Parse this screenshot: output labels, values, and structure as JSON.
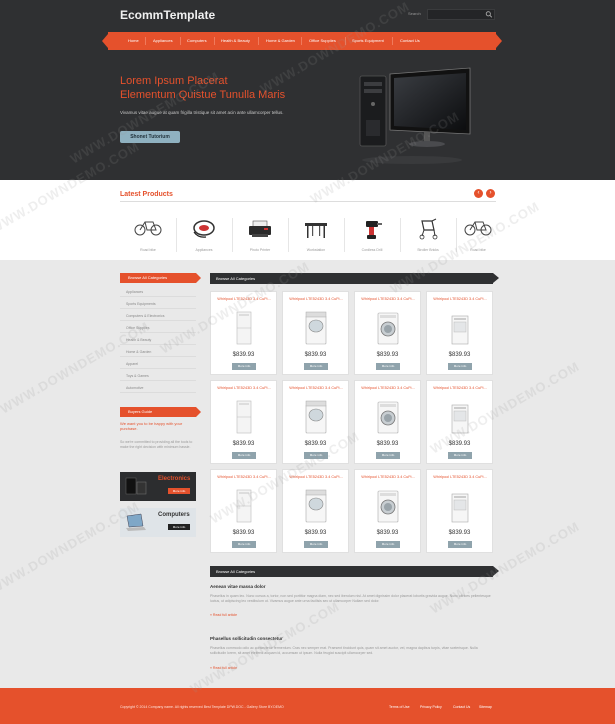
{
  "header": {
    "logo": "EcommTemplate",
    "search_label": "Search",
    "search_placeholder": "",
    "nav": [
      "Home",
      "Appliances",
      "Computers",
      "Health & Beauty",
      "Home & Garden",
      "Office Supplies",
      "Sports Equipment",
      "Contact Us"
    ]
  },
  "hero": {
    "title_line1": "Lorem Ipsum Placerat",
    "title_line2": "Elementum Quistue Tunulla Maris",
    "text": "Vivamus vitae augue at quam frigilla tristique sit amet acin ante ullamcorper  tellus.",
    "button": "Shonet Tutorium"
  },
  "latest": {
    "title": "Latest Products",
    "prev": "‹",
    "next": "›",
    "items": [
      "Road bike",
      "Appliances",
      "Photo Printer",
      "Workstation",
      "Cordless Drill",
      "Stroller Bricks",
      "Road bike"
    ]
  },
  "sidebar": {
    "categories_title": "Browse All Categories",
    "categories": [
      "Appliances",
      "Sports Equipments",
      "Computers & Electronics",
      "Office Supplies",
      "Health & Beauty",
      "Home & Garden",
      "Apparel",
      "Toys & Games",
      "Automotive"
    ],
    "buyers_title": "Buyers Guide",
    "buyers_text_a": "We want you to be happy with your purchase.",
    "buyers_text_b": "So we're committed to providing all the tools to make the right decision with minimum hassle.",
    "promo1_title": "Electronics",
    "promo1_btn": "More info",
    "promo2_title": "Computers",
    "promo2_btn": "More info"
  },
  "main": {
    "grid_title": "Browse All Categories",
    "products": [
      {
        "name": "Whirlpool LTE5243D 3.4 CuFt...",
        "price": "$839.93",
        "btn": "More info",
        "img": "stack-washer-icon"
      },
      {
        "name": "Whirlpool LTE5243D 3.4 CuFt...",
        "price": "$839.93",
        "btn": "More info",
        "img": "top-load-washer-icon"
      },
      {
        "name": "Whirlpool LTE5243D 3.4 CuFt...",
        "price": "$839.93",
        "btn": "More info",
        "img": "front-load-washer-icon"
      },
      {
        "name": "Whirlpool LTE5243D 3.4 CuFt...",
        "price": "$839.93",
        "btn": "More info",
        "img": "compact-washer-icon"
      },
      {
        "name": "Whirlpool LTE5243D 3.4 CuFt...",
        "price": "$839.93",
        "btn": "More info",
        "img": "stack-washer-icon"
      },
      {
        "name": "Whirlpool LTE5243D 3.4 CuFt...",
        "price": "$839.93",
        "btn": "More info",
        "img": "top-load-washer-icon"
      },
      {
        "name": "Whirlpool LTE5243D 3.4 CuFt...",
        "price": "$839.93",
        "btn": "More info",
        "img": "front-load-washer-icon"
      },
      {
        "name": "Whirlpool LTE5243D 3.4 CuFt...",
        "price": "$839.93",
        "btn": "More info",
        "img": "compact-washer-icon"
      },
      {
        "name": "Whirlpool LTE5243D 3.4 CuFt...",
        "price": "$839.93",
        "btn": "More info",
        "img": "stack-washer-icon"
      },
      {
        "name": "Whirlpool LTE5243D 3.4 CuFt...",
        "price": "$839.93",
        "btn": "More info",
        "img": "top-load-washer-icon"
      },
      {
        "name": "Whirlpool LTE5243D 3.4 CuFt...",
        "price": "$839.93",
        "btn": "More info",
        "img": "front-load-washer-icon"
      },
      {
        "name": "Whirlpool LTE5243D 3.4 CuFt...",
        "price": "$839.93",
        "btn": "More info",
        "img": "compact-washer-icon"
      }
    ],
    "articles_title": "Browse All Categories",
    "article1_title": "Aenean vitae massa dolor",
    "article1_body": "Phasellus in quam leo. Nunc cursus a, tortor, non sed porttitor magna diam, nec sed ibendum nisl. At amet dignissim dolor placerat lobortis gravida augue. Nunc ultrices pellentesque luctus, ut adipiscing leo vestibulum ut. Vivamus augue ante urna facilisis sec ut ullamcorper Nullam sed dolor.",
    "article1_link": "» Read full article",
    "article2_title": "Phasellus sollicitudin consectetur",
    "article2_body": "Phasellus commodo odio ac consectetur fermentum. Cras nec semper erat. Praesent tincidunt quis, quam sit amet auctor, vel, magna dapibus turpis, vitae scelerisque. Nulla sollicitudin lorem, sit amet eleifend aliquam id, accumsan ut ipsum. Nulla feugiat suscipit ullamcorper sed.",
    "article2_link": "» Read full article"
  },
  "footer": {
    "copyright": "Copyright © 2014 Company name. All rights reserved Best Template DPW.DOC - Gallery Store BY.DEMO",
    "links": [
      "Terms of Use",
      "Privacy Policy",
      "Contact Us",
      "Sitemap"
    ]
  },
  "watermark": "WWW.DOWNDEMO.COM",
  "colors": {
    "accent": "#e5512c",
    "dark": "#2f3032",
    "button_blue": "#8fb1c0"
  }
}
